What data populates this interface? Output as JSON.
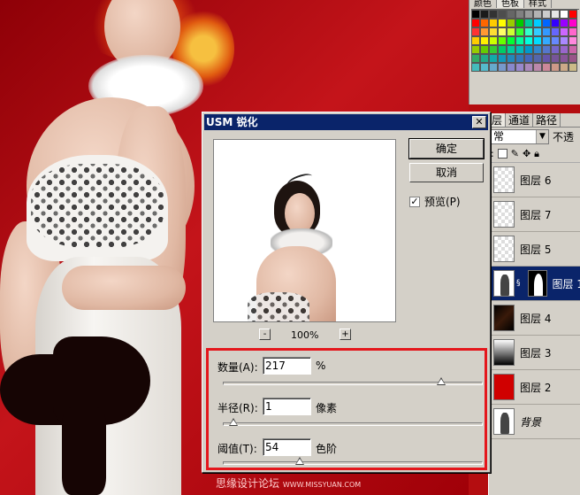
{
  "swatches": {
    "tabs": [
      "颜色",
      "色板",
      "样式"
    ],
    "active_tab": 1,
    "colors": [
      "#000000",
      "#1a1a1a",
      "#333333",
      "#4d4d4d",
      "#666666",
      "#808080",
      "#999999",
      "#b3b3b3",
      "#cccccc",
      "#e6e6e6",
      "#ffffff",
      "#ff0000",
      "#ff0000",
      "#ff6600",
      "#ffcc00",
      "#ffff00",
      "#99cc00",
      "#00cc00",
      "#00cc99",
      "#00ccff",
      "#0066ff",
      "#3300ff",
      "#9900ff",
      "#ff00cc",
      "#ff3333",
      "#ff9933",
      "#ffdd33",
      "#ffff66",
      "#ccff33",
      "#33ff33",
      "#33ffcc",
      "#33ccff",
      "#3399ff",
      "#6666ff",
      "#cc66ff",
      "#ff66cc",
      "#ffcc00",
      "#ffee00",
      "#ccff00",
      "#66ff00",
      "#00ff33",
      "#00ff99",
      "#00ffdd",
      "#00ddff",
      "#33aaff",
      "#6688ff",
      "#aa88ff",
      "#ff88dd",
      "#99cc00",
      "#66cc00",
      "#33cc33",
      "#00cc66",
      "#00cc99",
      "#00bbbb",
      "#0099cc",
      "#3388cc",
      "#5577cc",
      "#7766cc",
      "#9966cc",
      "#cc66aa",
      "#33aa66",
      "#22aa88",
      "#11aaaa",
      "#1199bb",
      "#2288bb",
      "#3377bb",
      "#4466bb",
      "#5566aa",
      "#6655aa",
      "#775599",
      "#885599",
      "#995588",
      "#44bbbb",
      "#55bbcc",
      "#66aacc",
      "#7799cc",
      "#8888cc",
      "#9988cc",
      "#aa88bb",
      "#bb88aa",
      "#cc8899",
      "#cc9988",
      "#ccaa88",
      "#ccbb88"
    ]
  },
  "layers_panel": {
    "tabs": [
      "层",
      "通道",
      "路径"
    ],
    "active_tab": 0,
    "blend_mode": "常",
    "opacity_label": "不透",
    "layers": [
      {
        "name": "图层 6",
        "thumb": "checker",
        "selected": false
      },
      {
        "name": "图层 7",
        "thumb": "checker",
        "selected": false
      },
      {
        "name": "图层 5",
        "thumb": "checker",
        "selected": false
      },
      {
        "name": "图层 1",
        "thumb": "photo",
        "selected": true,
        "mask": true
      },
      {
        "name": "图层 4",
        "thumb": "dark",
        "selected": false
      },
      {
        "name": "图层 3",
        "thumb": "grad",
        "selected": false
      },
      {
        "name": "图层 2",
        "thumb": "red",
        "selected": false
      },
      {
        "name": "背景",
        "thumb": "photo",
        "selected": false,
        "italic": true
      }
    ]
  },
  "dialog": {
    "title": "USM 锐化",
    "close_glyph": "✕",
    "ok_label": "确定",
    "cancel_label": "取消",
    "preview_label": "预览(P)",
    "preview_checked": true,
    "zoom_out": "-",
    "zoom_in": "+",
    "zoom_level": "100%",
    "amount": {
      "label": "数量(A):",
      "value": "217",
      "unit": "%",
      "fraction": 0.85
    },
    "radius": {
      "label": "半径(R):",
      "value": "1",
      "unit": "像素",
      "fraction": 0.04
    },
    "threshold": {
      "label": "阈值(T):",
      "value": "54",
      "unit": "色阶",
      "fraction": 0.3
    }
  },
  "watermark": {
    "cn": "思缘设计论坛",
    "url": "WWW.MISSYUAN.COM"
  },
  "colors": {
    "title_bar": "#0a246a",
    "highlight_box": "#e4161c",
    "background_red": "#b40d10"
  }
}
